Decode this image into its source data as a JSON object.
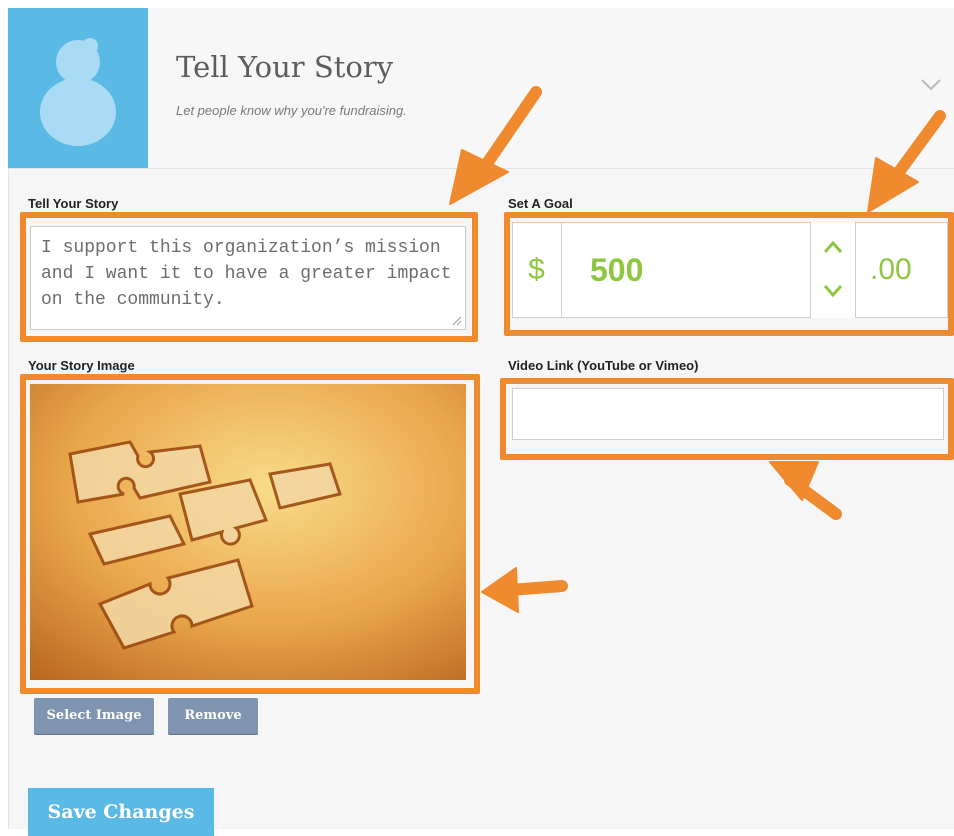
{
  "header": {
    "title": "Tell Your Story",
    "subtitle": "Let people know why you're fundraising."
  },
  "story": {
    "label": "Tell Your Story",
    "text": "I support this organization’s mission and I want it to have a greater impact on the community."
  },
  "goal": {
    "label": "Set A Goal",
    "currency": "$",
    "amount": "500",
    "cents": ".00"
  },
  "image": {
    "label": "Your Story Image",
    "select_label": "Select Image",
    "remove_label": "Remove"
  },
  "video": {
    "label": "Video Link (YouTube or Vimeo)",
    "value": "",
    "placeholder": ""
  },
  "save_label": "Save Changes",
  "colors": {
    "accent_blue": "#5bb9e6",
    "goal_green": "#8dc63f",
    "highlight_orange": "#ef8a2e",
    "button_grey": "#7f94ae"
  },
  "icons": [
    "avatar-icon",
    "chevron-down-icon",
    "chevron-up-icon",
    "resize-handle-icon"
  ]
}
